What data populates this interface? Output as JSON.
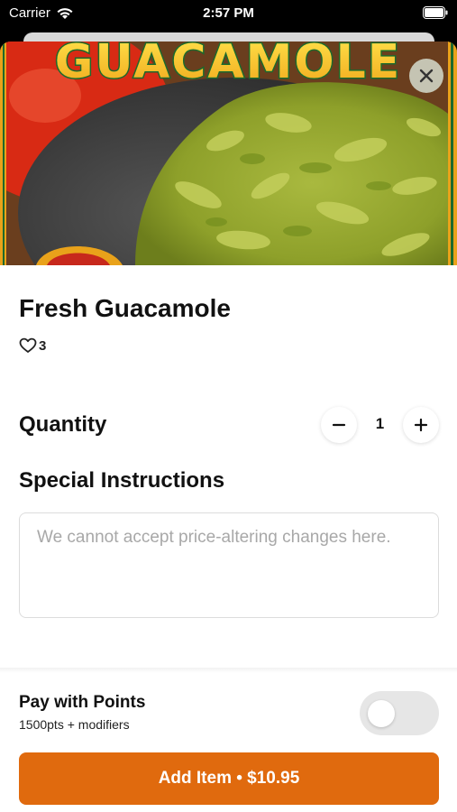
{
  "status_bar": {
    "carrier": "Carrier",
    "time": "2:57 PM"
  },
  "hero": {
    "logo_text": "GUACAMOLE"
  },
  "item": {
    "title": "Fresh Guacamole",
    "likes": "3"
  },
  "quantity": {
    "label": "Quantity",
    "value": "1"
  },
  "instructions": {
    "label": "Special Instructions",
    "placeholder": "We cannot accept price-altering changes here."
  },
  "points": {
    "title": "Pay with Points",
    "subtitle": "1500pts + modifiers",
    "enabled": false
  },
  "add_button": {
    "label": "Add Item • $10.95"
  },
  "colors": {
    "accent": "#e06a0e",
    "toggle_off": "#e6e6e6"
  },
  "icons": {
    "close": "close-icon",
    "heart": "heart-icon",
    "minus": "minus-icon",
    "plus": "plus-icon",
    "wifi": "wifi-icon",
    "battery": "battery-icon"
  }
}
